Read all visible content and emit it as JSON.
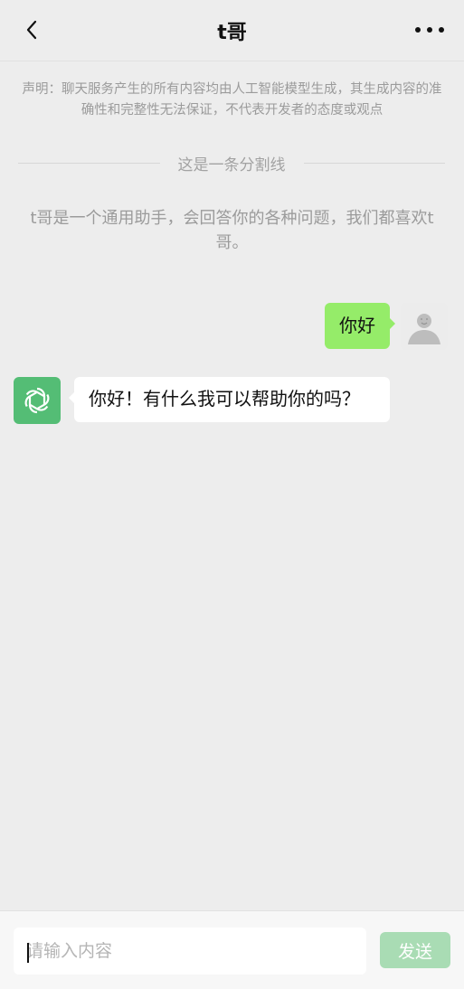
{
  "header": {
    "title": "t哥",
    "back_icon": "chevron-left-icon",
    "more_icon": "more-dots-icon"
  },
  "disclaimer": "声明：聊天服务产生的所有内容均由人工智能模型生成，其生成内容的准确性和完整性无法保证，不代表开发者的态度或观点",
  "divider_label": "这是一条分割线",
  "intro": "t哥是一个通用助手，会回答你的各种问题，我们都喜欢t哥。",
  "messages": [
    {
      "role": "user",
      "text": "你好"
    },
    {
      "role": "assistant",
      "text": "你好！有什么我可以帮助你的吗？"
    }
  ],
  "input": {
    "placeholder": "请输入内容",
    "value": ""
  },
  "send_label": "发送",
  "colors": {
    "background": "#ededed",
    "user_bubble": "#95ec69",
    "bot_avatar": "#54bd75",
    "send_button": "#a9dcb4"
  }
}
